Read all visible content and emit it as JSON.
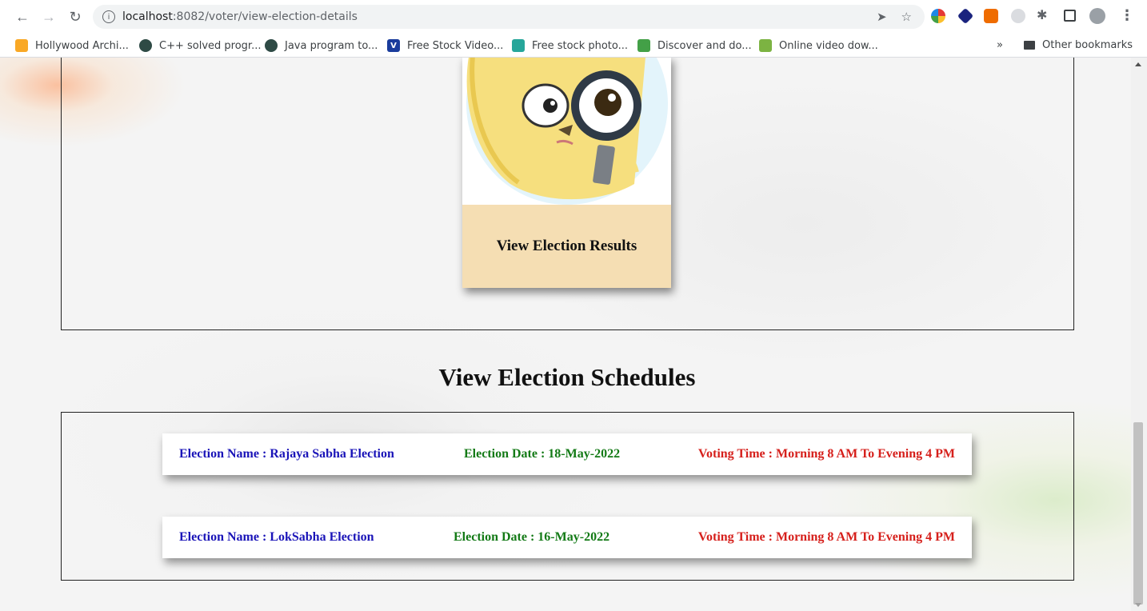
{
  "browser": {
    "url_host": "localhost",
    "url_path": ":8082/voter/view-election-details",
    "bookmarks": [
      "Hollywood Archi...",
      "C++ solved progr...",
      "Java program to...",
      "Free Stock Video...",
      "Free stock photo...",
      "Discover and do...",
      "Online video dow..."
    ],
    "more_label": "»",
    "other_bookmarks": "Other bookmarks",
    "icons": [
      "back-icon",
      "forward-icon",
      "reload-icon",
      "info-icon",
      "send-icon",
      "star-icon",
      "extension-icon",
      "menu-icon"
    ]
  },
  "card": {
    "title": "View Election Results"
  },
  "schedules": {
    "heading": "View Election Schedules",
    "rows": [
      {
        "name": "Election Name : Rajaya Sabha Election",
        "date": "Election Date : 18-May-2022",
        "time": "Voting Time : Morning 8 AM To Evening 4 PM"
      },
      {
        "name": "Election Name : LokSabha Election",
        "date": "Election Date : 16-May-2022",
        "time": "Voting Time : Morning 8 AM To Evening 4 PM"
      }
    ]
  },
  "colors": {
    "name": "#1a14b8",
    "date": "#137a16",
    "time": "#d6201c",
    "card_footer": "#f5deb3"
  }
}
